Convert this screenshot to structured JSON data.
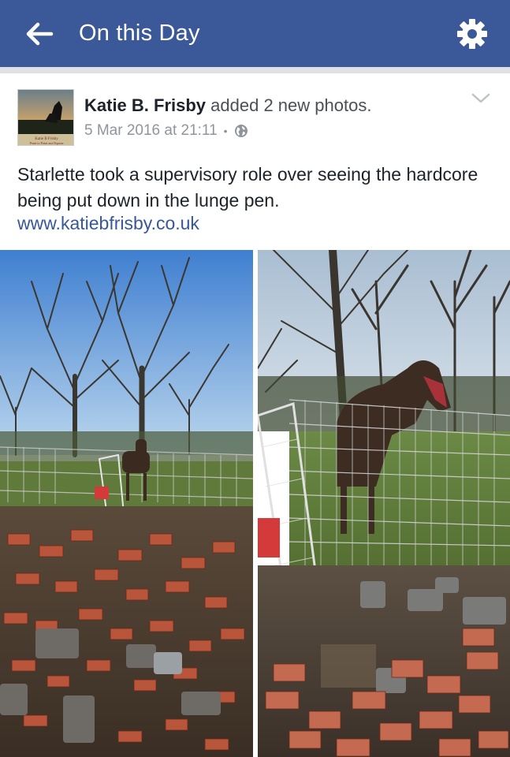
{
  "header": {
    "title": "On this Day",
    "back_icon": "arrow-left-icon",
    "settings_icon": "gear-icon",
    "bg_color": "#3b5998"
  },
  "post": {
    "author": "Katie B. Frisby",
    "action": "added 2 new photos.",
    "timestamp": "5 Mar 2016 at 21:11",
    "separator": "•",
    "privacy_icon": "globe-icon",
    "menu_icon": "chevron-down-icon",
    "text": "Starlette took a supervisory role over seeing the hardcore being put down in the lunge pen.",
    "link": "www.katiebfrisby.co.uk",
    "avatar_text": {
      "name": "Katie B Frisby",
      "subtitle": "Point to Point and Equine"
    }
  },
  "photos": [
    {
      "name": "photo-left",
      "description_icon": "photo"
    },
    {
      "name": "photo-right",
      "description_icon": "photo"
    }
  ]
}
